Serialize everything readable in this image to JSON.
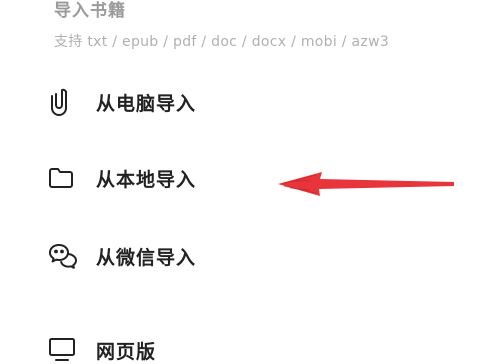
{
  "header": {
    "title": "导入书籍",
    "subtitle": "支持 txt / epub / pdf / doc / docx / mobi / azw3"
  },
  "options": [
    {
      "label": "从电脑导入",
      "icon": "paperclip-icon"
    },
    {
      "label": "从本地导入",
      "icon": "folder-icon"
    },
    {
      "label": "从微信导入",
      "icon": "wechat-icon"
    },
    {
      "label": "网页版",
      "icon": "monitor-icon"
    }
  ],
  "annotation": {
    "arrow_color": "#e8353b",
    "points_to": "从本地导入"
  },
  "colors": {
    "text": "#222222",
    "muted": "#9a9a9a",
    "background": "#ffffff"
  }
}
